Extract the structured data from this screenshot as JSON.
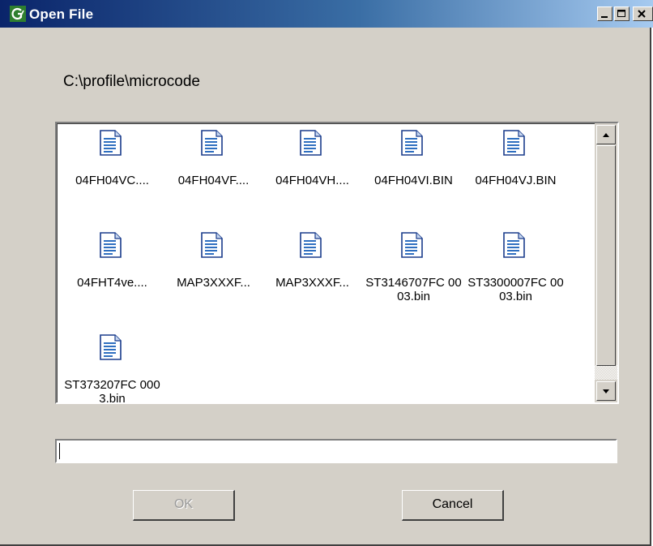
{
  "window": {
    "title": "Open File",
    "app_icon": "grass-valley-g-logo",
    "controls": [
      "minimize-icon",
      "maximize-icon",
      "close-icon"
    ]
  },
  "path": "C:\\profile\\microcode",
  "files": [
    {
      "name": "04FH04VC...."
    },
    {
      "name": "04FH04VF...."
    },
    {
      "name": "04FH04VH...."
    },
    {
      "name": "04FH04VI.BIN"
    },
    {
      "name": "04FH04VJ.BIN"
    },
    {
      "name": "04FHT4ve...."
    },
    {
      "name": "MAP3XXXF..."
    },
    {
      "name": "MAP3XXXF..."
    },
    {
      "name": "ST3146707FC 0003.bin"
    },
    {
      "name": "ST3300007FC 0003.bin"
    },
    {
      "name": "ST373207FC 0003.bin"
    }
  ],
  "filename_input": {
    "value": ""
  },
  "buttons": {
    "ok": "OK",
    "cancel": "Cancel"
  },
  "colors": {
    "title_bar_start": "#0a246a",
    "title_bar_end": "#a6caf0",
    "face": "#d4d0c8"
  }
}
